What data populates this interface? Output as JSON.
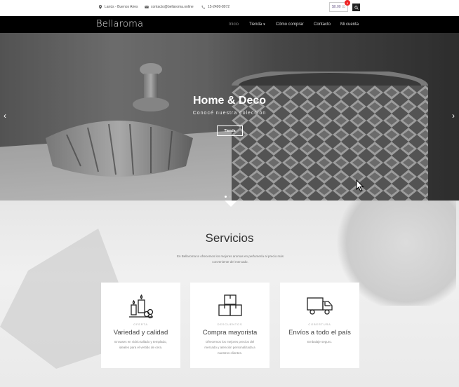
{
  "topbar": {
    "location": "Lanús - Buenos Aires",
    "email": "contacto@bellaroma.online",
    "phone": "15-2490-8972",
    "cart_total": "$0.00",
    "cart_count": "0"
  },
  "header": {
    "logo": "Bellaroma",
    "nav": [
      "Inicio",
      "Tienda",
      "Cómo comprar",
      "Contacto",
      "Mi cuenta"
    ]
  },
  "hero": {
    "title": "Home & Deco",
    "subtitle": "Conocé nuestra colección",
    "button": "Tienda",
    "prev_arrow": "‹",
    "next_arrow": "›"
  },
  "services": {
    "title": "Servicios",
    "description": "En Bellaroma te ofrecemos los mejores aromas en perfumería al precio más conveniente del mercado.",
    "cards": [
      {
        "icon": "candles-icon",
        "category": "OFERTA",
        "title": "Variedad y calidad",
        "text": "Envases en vidrio tallado y templado, ideales para el vertido de cera."
      },
      {
        "icon": "boxes-icon",
        "category": "DESCUENTOS",
        "title": "Compra mayorista",
        "text": "Ofrecemos los mejores precios del mercado y atención personalizada a nuestros clientes."
      },
      {
        "icon": "truck-icon",
        "category": "COBERTURA",
        "title": "Envíos a todo el país",
        "text": "Embalaje seguro."
      }
    ]
  },
  "colors": {
    "nav_bg": "#000000",
    "cart_badge": "#e22222",
    "accent_text": "#6a5a8a"
  }
}
